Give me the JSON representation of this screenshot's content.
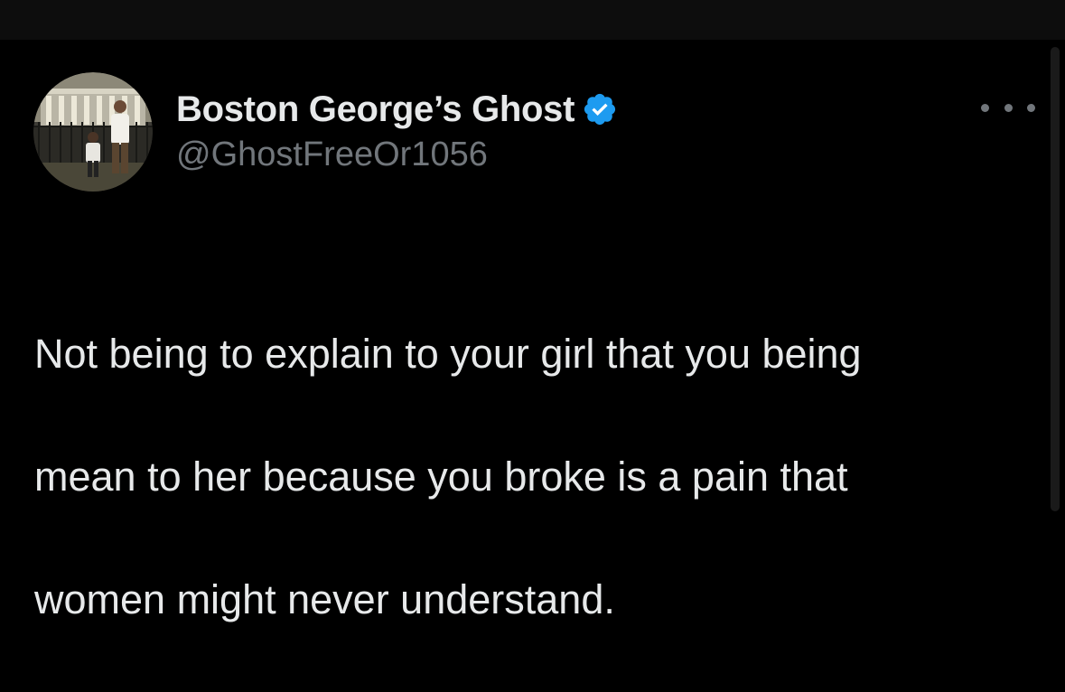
{
  "tweet": {
    "author": {
      "display_name": "Boston George’s Ghost",
      "handle": "@GhostFreeOr1056",
      "verified": true,
      "verified_badge_color": "#1d9bf0",
      "avatar_icon": "profile-photo-avatar"
    },
    "text_lines": [
      "Not being to explain to your girl that you being",
      "mean to her because you broke is a pain that",
      "women might never understand."
    ],
    "menu_icon": "more-options-icon"
  },
  "theme": {
    "background": "#000000",
    "primary_text": "#e7e9ea",
    "secondary_text": "#71767b"
  }
}
